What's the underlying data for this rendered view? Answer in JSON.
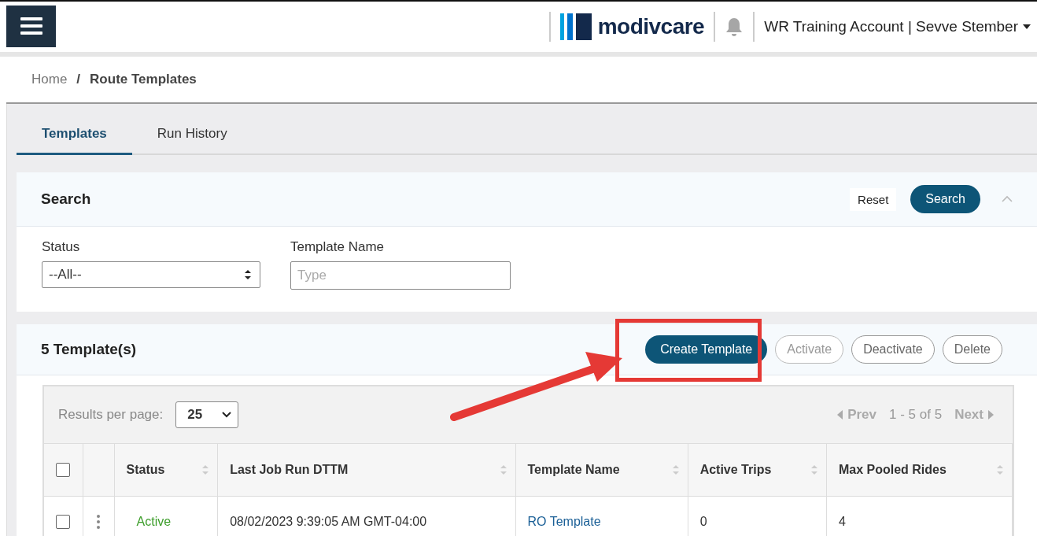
{
  "header": {
    "logo": "modivcare",
    "account": "WR Training Account | Sevve Stember"
  },
  "breadcrumb_separator": "/",
  "breadcrumb": [
    {
      "label": "Home",
      "current": false
    },
    {
      "label": "Route Templates",
      "current": true
    }
  ],
  "tabs": [
    {
      "label": "Templates",
      "selected": true
    },
    {
      "label": "Run History",
      "selected": false
    }
  ],
  "search": {
    "title": "Search",
    "reset": "Reset",
    "button": "Search",
    "expanded": true,
    "fields": [
      {
        "kind": "select",
        "label": "Status",
        "value": "--All--"
      },
      {
        "kind": "text",
        "label": "Template Name",
        "placeholder": "Type"
      }
    ]
  },
  "templates": {
    "title": "5 Template(s)",
    "actions": [
      {
        "label": "Create Template",
        "kind": "primary",
        "disabled": false,
        "highlighted": true
      },
      {
        "label": "Activate",
        "kind": "outline",
        "disabled": true,
        "highlighted": false
      },
      {
        "label": "Deactivate",
        "kind": "outline",
        "disabled": false,
        "highlighted": false
      },
      {
        "label": "Delete",
        "kind": "outline",
        "disabled": false,
        "highlighted": false
      }
    ],
    "per_page_label": "Results per page:",
    "per_page": "25",
    "prev": {
      "label": "Prev",
      "disabled": true
    },
    "range": "1 - 5 of 5",
    "next": {
      "label": "Next",
      "disabled": true
    },
    "select_all": {
      "checked": false
    },
    "columns": [
      "Status",
      "Last Job Run DTTM",
      "Template Name",
      "Active Trips",
      "Max Pooled Rides"
    ],
    "rows": [
      {
        "checked": false,
        "status": "Active",
        "last_run": "08/02/2023 9:39:05 AM GMT-04:00",
        "name": "RO Template",
        "active_trips": "0",
        "max_pooled": "4"
      }
    ]
  }
}
